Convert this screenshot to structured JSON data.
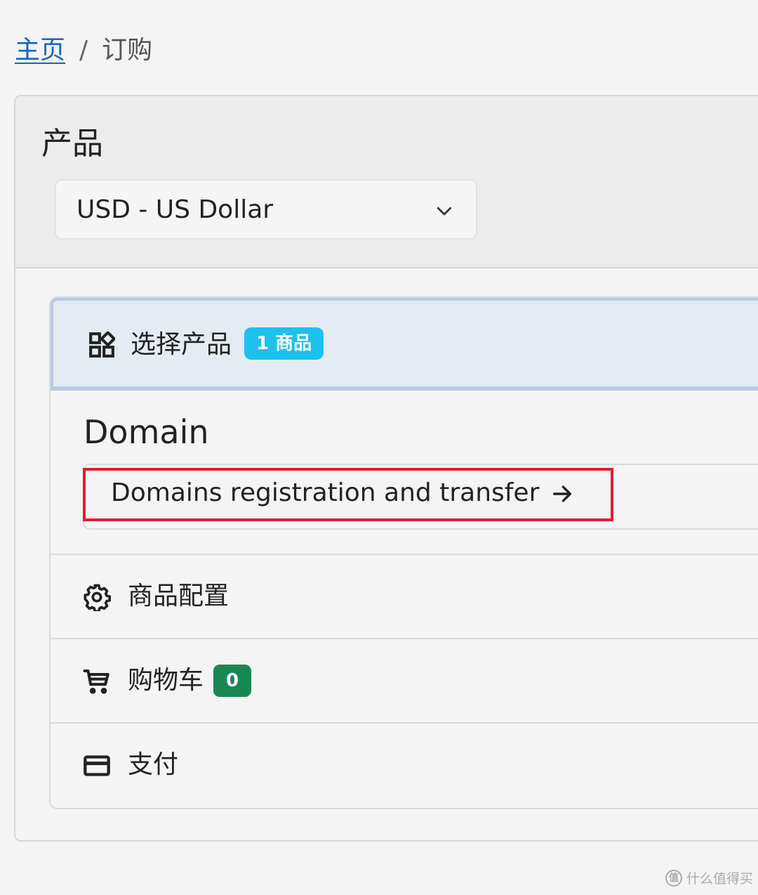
{
  "breadcrumb": {
    "home": "主页",
    "separator": "/",
    "current": "订购"
  },
  "card": {
    "title": "产品",
    "currency_select": {
      "value": "USD - US Dollar",
      "icon": "chevron-down-icon"
    }
  },
  "steps": {
    "select_product": {
      "icon": "grid-icon",
      "label": "选择产品",
      "badge": "1 商品",
      "badge_color": "#1ec0ec"
    },
    "domain": {
      "title": "Domain",
      "link": "Domains registration and transfer",
      "link_icon": "arrow-right-icon",
      "highlight_color": "#e01f2f"
    },
    "configure": {
      "icon": "gear-icon",
      "label": "商品配置"
    },
    "cart": {
      "icon": "cart-icon",
      "label": "购物车",
      "badge": "0",
      "badge_color": "#198754"
    },
    "payment": {
      "icon": "credit-card-icon",
      "label": "支付"
    }
  },
  "watermark": {
    "logo": "值",
    "text": "什么值得买"
  }
}
